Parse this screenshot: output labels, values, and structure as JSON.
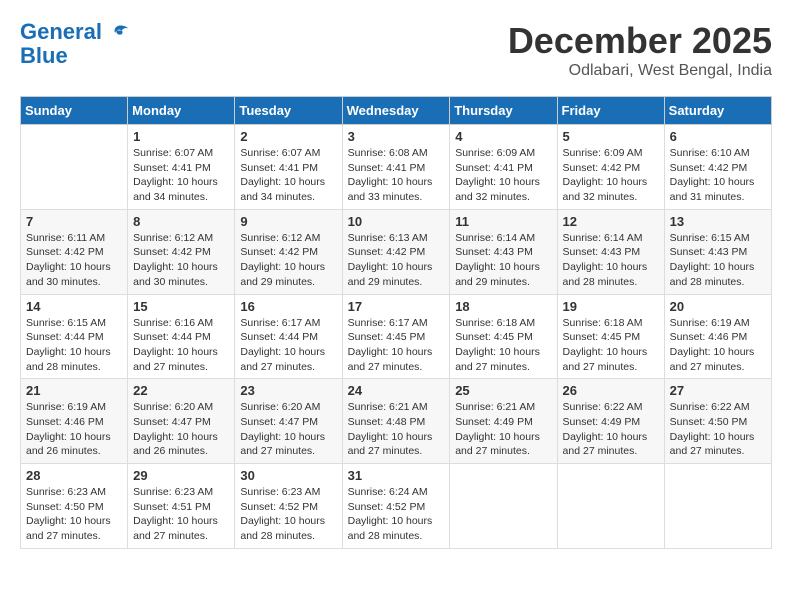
{
  "header": {
    "logo_line1": "General",
    "logo_line2": "Blue",
    "month": "December 2025",
    "location": "Odlabari, West Bengal, India"
  },
  "weekdays": [
    "Sunday",
    "Monday",
    "Tuesday",
    "Wednesday",
    "Thursday",
    "Friday",
    "Saturday"
  ],
  "weeks": [
    [
      {
        "day": "",
        "info": ""
      },
      {
        "day": "1",
        "info": "Sunrise: 6:07 AM\nSunset: 4:41 PM\nDaylight: 10 hours\nand 34 minutes."
      },
      {
        "day": "2",
        "info": "Sunrise: 6:07 AM\nSunset: 4:41 PM\nDaylight: 10 hours\nand 34 minutes."
      },
      {
        "day": "3",
        "info": "Sunrise: 6:08 AM\nSunset: 4:41 PM\nDaylight: 10 hours\nand 33 minutes."
      },
      {
        "day": "4",
        "info": "Sunrise: 6:09 AM\nSunset: 4:41 PM\nDaylight: 10 hours\nand 32 minutes."
      },
      {
        "day": "5",
        "info": "Sunrise: 6:09 AM\nSunset: 4:42 PM\nDaylight: 10 hours\nand 32 minutes."
      },
      {
        "day": "6",
        "info": "Sunrise: 6:10 AM\nSunset: 4:42 PM\nDaylight: 10 hours\nand 31 minutes."
      }
    ],
    [
      {
        "day": "7",
        "info": "Sunrise: 6:11 AM\nSunset: 4:42 PM\nDaylight: 10 hours\nand 30 minutes."
      },
      {
        "day": "8",
        "info": "Sunrise: 6:12 AM\nSunset: 4:42 PM\nDaylight: 10 hours\nand 30 minutes."
      },
      {
        "day": "9",
        "info": "Sunrise: 6:12 AM\nSunset: 4:42 PM\nDaylight: 10 hours\nand 29 minutes."
      },
      {
        "day": "10",
        "info": "Sunrise: 6:13 AM\nSunset: 4:42 PM\nDaylight: 10 hours\nand 29 minutes."
      },
      {
        "day": "11",
        "info": "Sunrise: 6:14 AM\nSunset: 4:43 PM\nDaylight: 10 hours\nand 29 minutes."
      },
      {
        "day": "12",
        "info": "Sunrise: 6:14 AM\nSunset: 4:43 PM\nDaylight: 10 hours\nand 28 minutes."
      },
      {
        "day": "13",
        "info": "Sunrise: 6:15 AM\nSunset: 4:43 PM\nDaylight: 10 hours\nand 28 minutes."
      }
    ],
    [
      {
        "day": "14",
        "info": "Sunrise: 6:15 AM\nSunset: 4:44 PM\nDaylight: 10 hours\nand 28 minutes."
      },
      {
        "day": "15",
        "info": "Sunrise: 6:16 AM\nSunset: 4:44 PM\nDaylight: 10 hours\nand 27 minutes."
      },
      {
        "day": "16",
        "info": "Sunrise: 6:17 AM\nSunset: 4:44 PM\nDaylight: 10 hours\nand 27 minutes."
      },
      {
        "day": "17",
        "info": "Sunrise: 6:17 AM\nSunset: 4:45 PM\nDaylight: 10 hours\nand 27 minutes."
      },
      {
        "day": "18",
        "info": "Sunrise: 6:18 AM\nSunset: 4:45 PM\nDaylight: 10 hours\nand 27 minutes."
      },
      {
        "day": "19",
        "info": "Sunrise: 6:18 AM\nSunset: 4:45 PM\nDaylight: 10 hours\nand 27 minutes."
      },
      {
        "day": "20",
        "info": "Sunrise: 6:19 AM\nSunset: 4:46 PM\nDaylight: 10 hours\nand 27 minutes."
      }
    ],
    [
      {
        "day": "21",
        "info": "Sunrise: 6:19 AM\nSunset: 4:46 PM\nDaylight: 10 hours\nand 26 minutes."
      },
      {
        "day": "22",
        "info": "Sunrise: 6:20 AM\nSunset: 4:47 PM\nDaylight: 10 hours\nand 26 minutes."
      },
      {
        "day": "23",
        "info": "Sunrise: 6:20 AM\nSunset: 4:47 PM\nDaylight: 10 hours\nand 27 minutes."
      },
      {
        "day": "24",
        "info": "Sunrise: 6:21 AM\nSunset: 4:48 PM\nDaylight: 10 hours\nand 27 minutes."
      },
      {
        "day": "25",
        "info": "Sunrise: 6:21 AM\nSunset: 4:49 PM\nDaylight: 10 hours\nand 27 minutes."
      },
      {
        "day": "26",
        "info": "Sunrise: 6:22 AM\nSunset: 4:49 PM\nDaylight: 10 hours\nand 27 minutes."
      },
      {
        "day": "27",
        "info": "Sunrise: 6:22 AM\nSunset: 4:50 PM\nDaylight: 10 hours\nand 27 minutes."
      }
    ],
    [
      {
        "day": "28",
        "info": "Sunrise: 6:23 AM\nSunset: 4:50 PM\nDaylight: 10 hours\nand 27 minutes."
      },
      {
        "day": "29",
        "info": "Sunrise: 6:23 AM\nSunset: 4:51 PM\nDaylight: 10 hours\nand 27 minutes."
      },
      {
        "day": "30",
        "info": "Sunrise: 6:23 AM\nSunset: 4:52 PM\nDaylight: 10 hours\nand 28 minutes."
      },
      {
        "day": "31",
        "info": "Sunrise: 6:24 AM\nSunset: 4:52 PM\nDaylight: 10 hours\nand 28 minutes."
      },
      {
        "day": "",
        "info": ""
      },
      {
        "day": "",
        "info": ""
      },
      {
        "day": "",
        "info": ""
      }
    ]
  ]
}
